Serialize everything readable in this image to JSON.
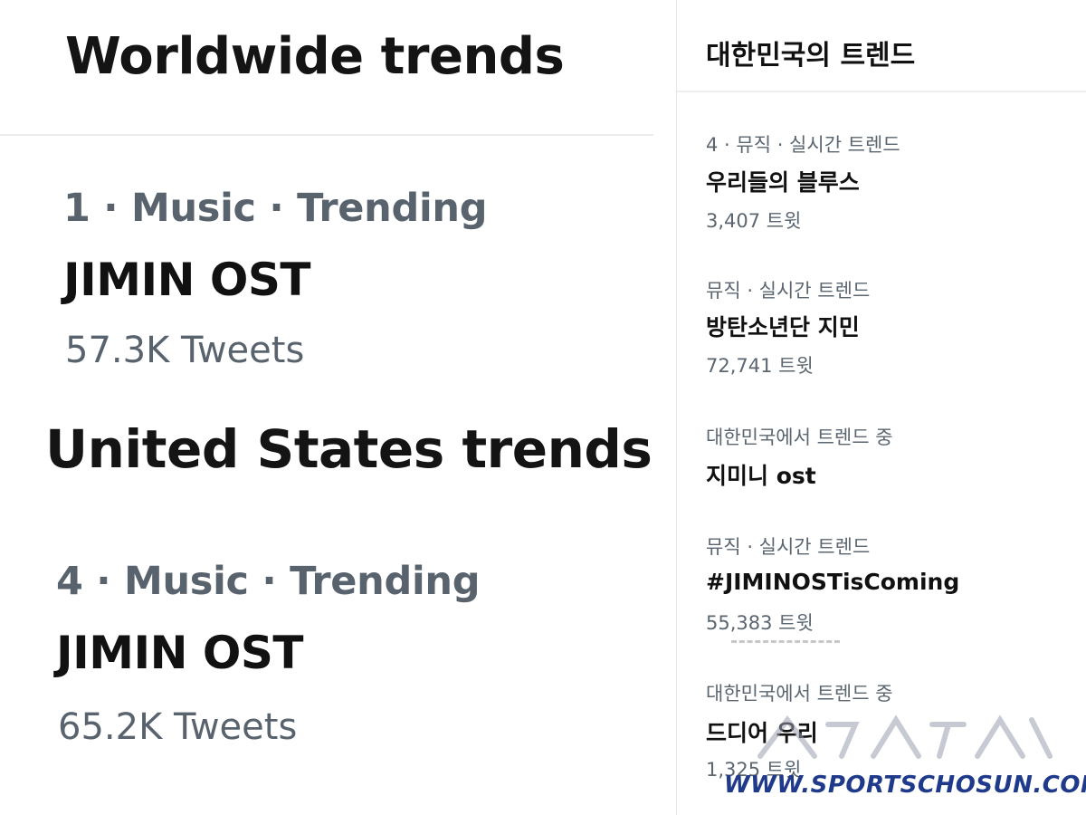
{
  "worldwide": {
    "title": "Worldwide trends",
    "trend": {
      "meta": "1 · Music · Trending",
      "name": "JIMIN OST",
      "count": "57.3K Tweets"
    }
  },
  "us": {
    "title": "United States trends",
    "trend": {
      "meta": "4 · Music · Trending",
      "name": "JIMIN OST",
      "count": "65.2K Tweets"
    }
  },
  "korea": {
    "title": "대한민국의 트렌드",
    "trends": [
      {
        "meta": "4 · 뮤직 · 실시간 트렌드",
        "name": "우리들의 블루스",
        "count": "3,407 트윗"
      },
      {
        "meta": "뮤직 · 실시간 트렌드",
        "name": "방탄소년단 지민",
        "count": "72,741 트윗"
      },
      {
        "meta": "대한민국에서 트렌드 중",
        "name": "지미니 ost"
      },
      {
        "meta": "뮤직 · 실시간 트렌드",
        "name": "#JIMINOSTisComing",
        "count": "55,383 트윗"
      },
      {
        "meta": "대한민국에서 트렌드 중",
        "name": "드디어 우리",
        "count": "1,325 트윗"
      }
    ]
  },
  "watermark": {
    "text": "WWW.SPORTSCHOSUN.COM"
  }
}
